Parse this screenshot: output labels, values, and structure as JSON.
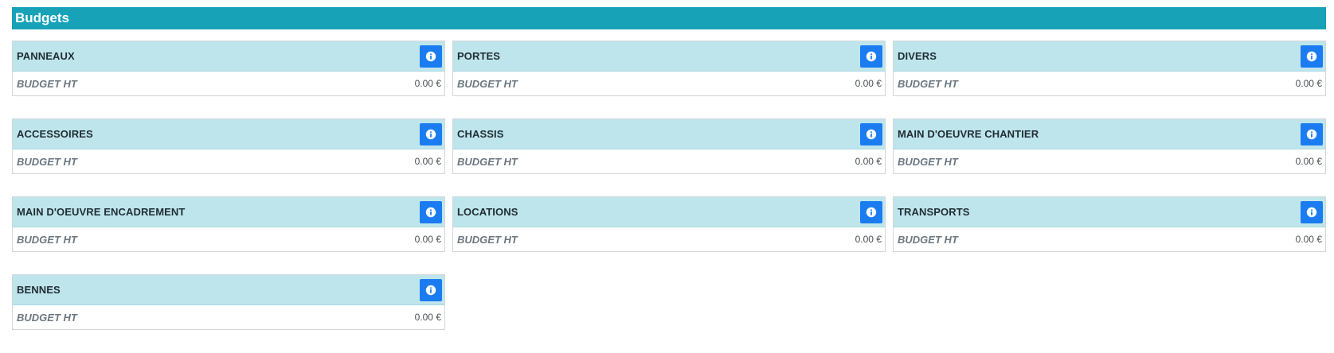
{
  "section": {
    "title": "Budgets"
  },
  "colors": {
    "header_bg": "#17a2b8",
    "card_head_bg": "#bfe5ec",
    "info_button": "#1a7cf0"
  },
  "cards": [
    {
      "title": "PANNEAUX",
      "label": "BUDGET HT",
      "value": "0.00 €",
      "icon": "info-icon"
    },
    {
      "title": "PORTES",
      "label": "BUDGET HT",
      "value": "0.00 €",
      "icon": "info-icon"
    },
    {
      "title": "DIVERS",
      "label": "BUDGET HT",
      "value": "0.00 €",
      "icon": "info-icon"
    },
    {
      "title": "ACCESSOIRES",
      "label": "BUDGET HT",
      "value": "0.00 €",
      "icon": "info-icon"
    },
    {
      "title": "CHASSIS",
      "label": "BUDGET HT",
      "value": "0.00 €",
      "icon": "info-icon"
    },
    {
      "title": "MAIN D'OEUVRE CHANTIER",
      "label": "BUDGET HT",
      "value": "0.00 €",
      "icon": "info-icon"
    },
    {
      "title": "MAIN D'OEUVRE ENCADREMENT",
      "label": "BUDGET HT",
      "value": "0.00 €",
      "icon": "info-icon"
    },
    {
      "title": "LOCATIONS",
      "label": "BUDGET HT",
      "value": "0.00 €",
      "icon": "info-icon"
    },
    {
      "title": "TRANSPORTS",
      "label": "BUDGET HT",
      "value": "0.00 €",
      "icon": "info-icon"
    },
    {
      "title": "BENNES",
      "label": "BUDGET HT",
      "value": "0.00 €",
      "icon": "info-icon"
    }
  ]
}
